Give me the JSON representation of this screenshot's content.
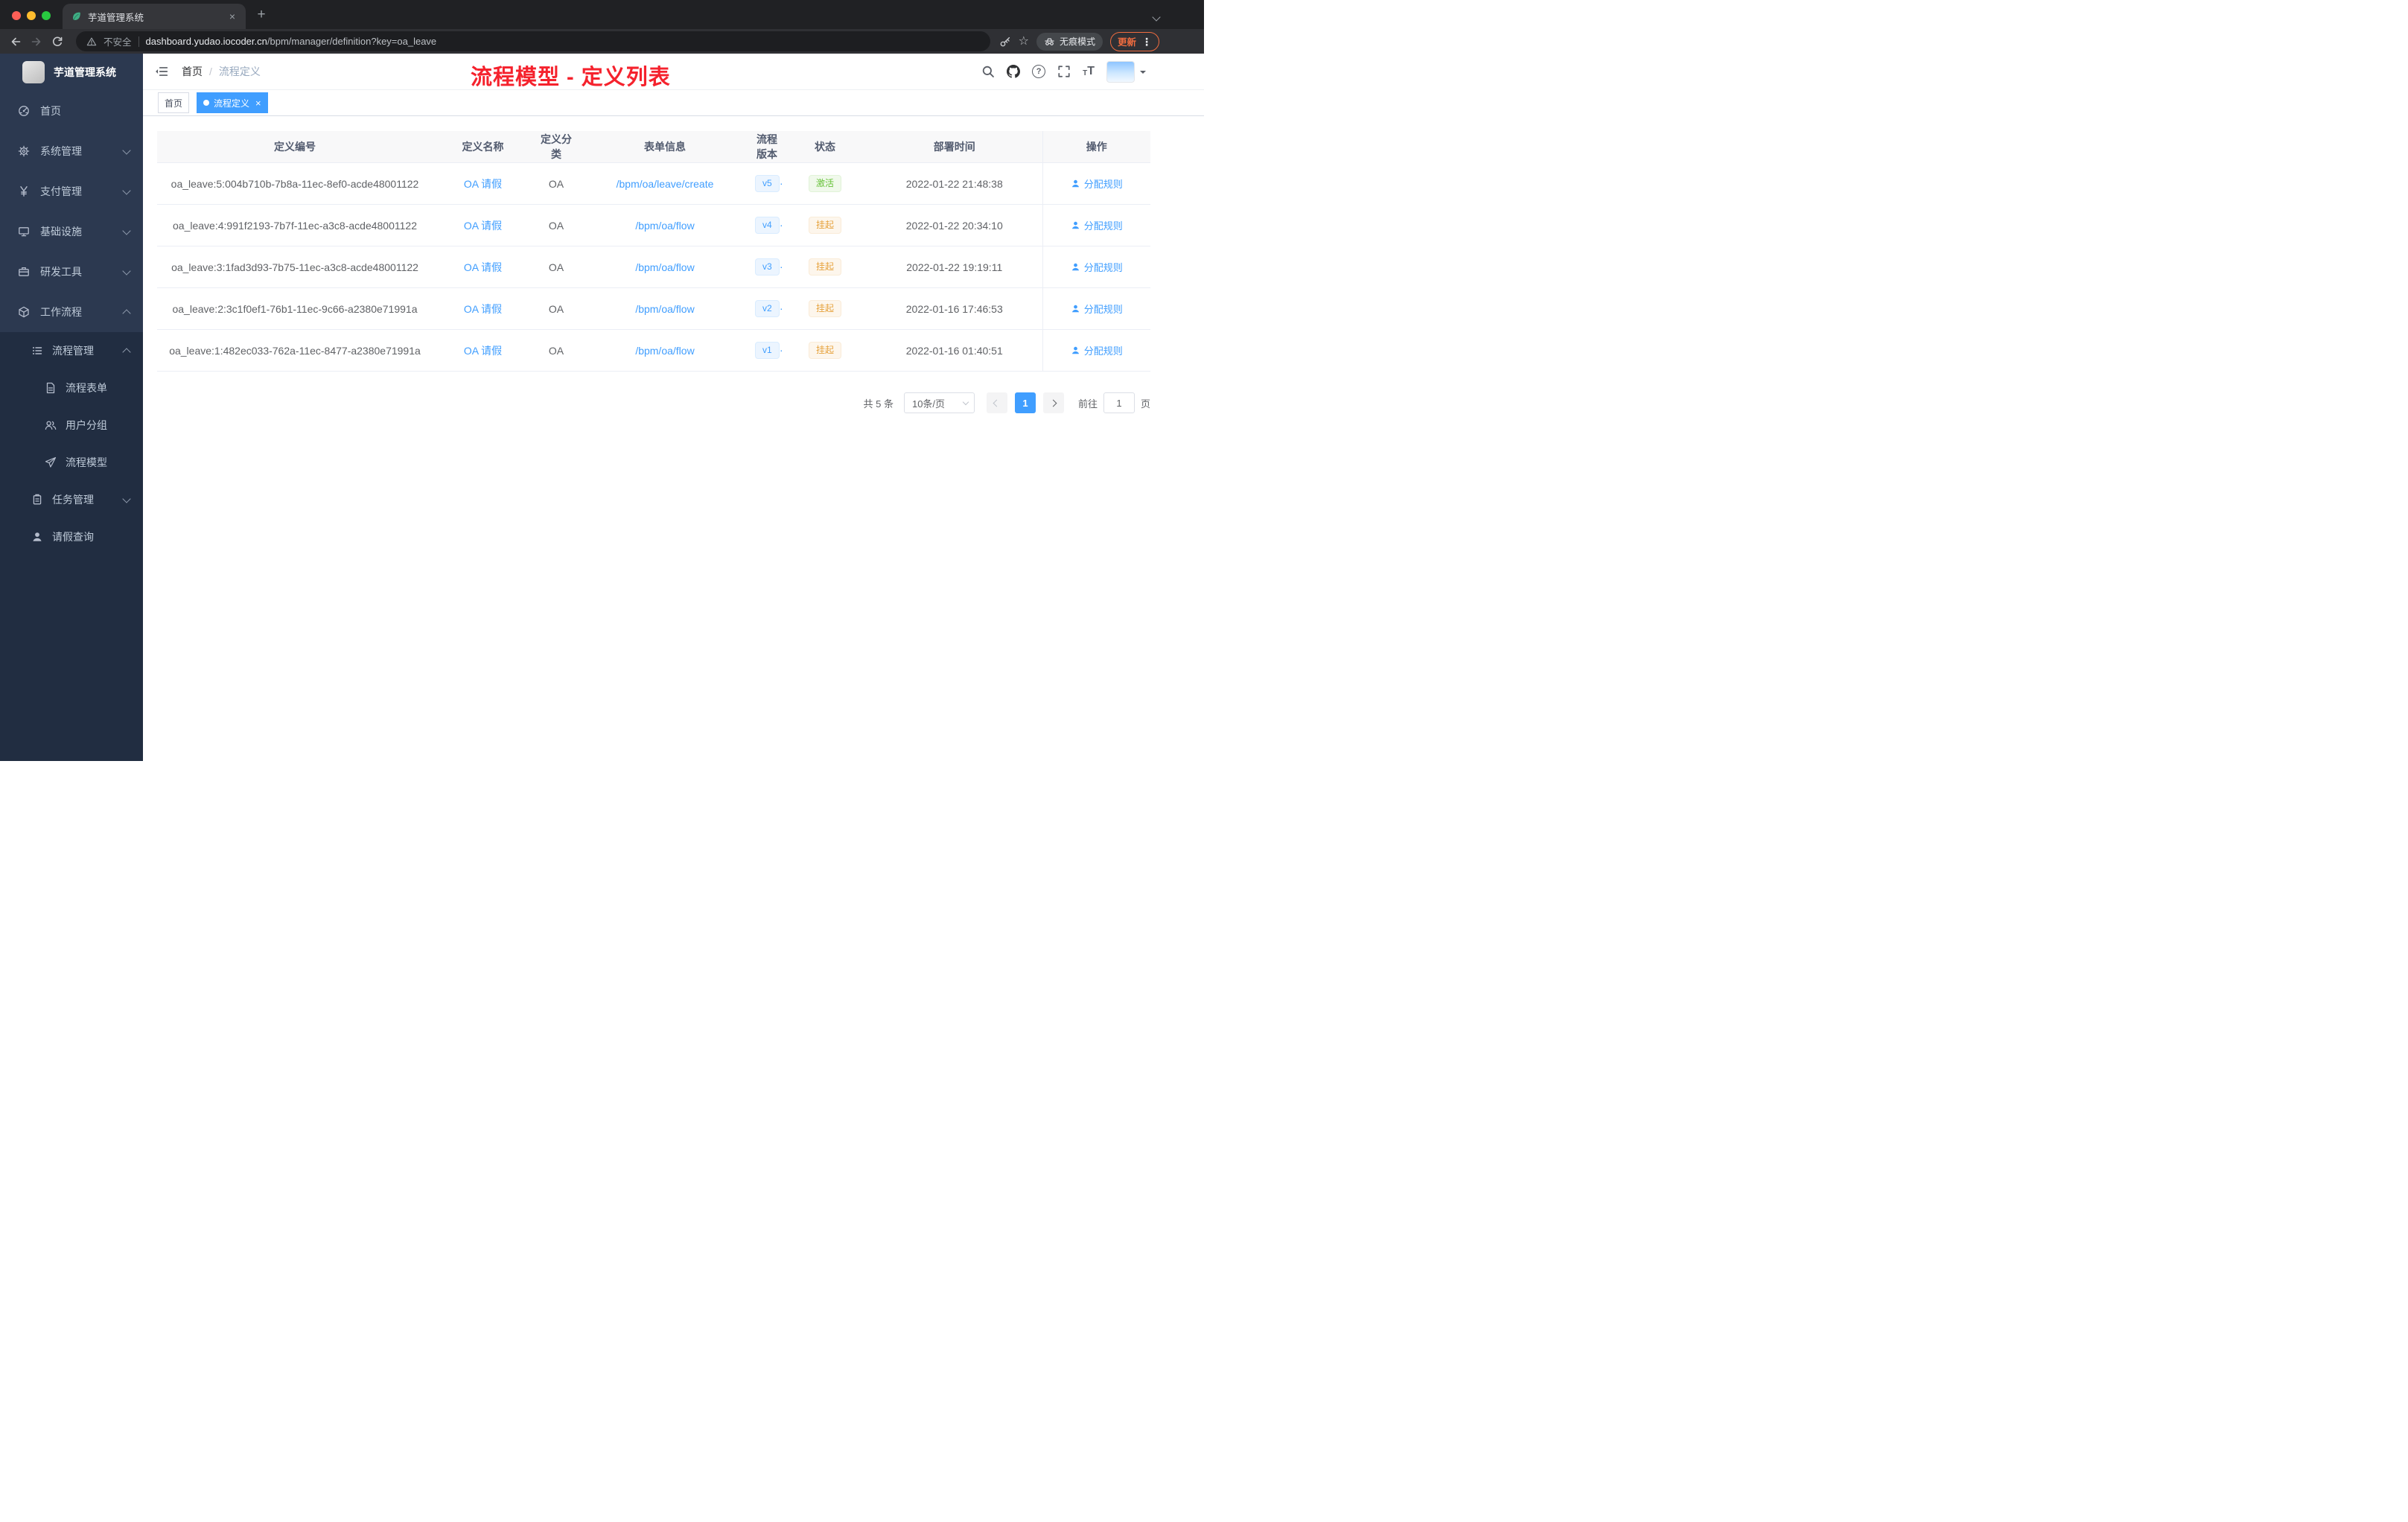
{
  "colors": {
    "accent": "#409eff",
    "success": "#67c23a",
    "warning": "#e6a23c",
    "annotation_red": "#f5222d",
    "update_orange": "#ef6c3f",
    "sidebar_bg": "#2c3950",
    "submenu_bg": "#212d41"
  },
  "browser": {
    "tab_title": "芋道管理系统",
    "security": "不安全",
    "url_domain": "dashboard.yudao.iocoder.cn",
    "url_path": "/bpm/manager/definition?key=oa_leave",
    "incognito": "无痕模式",
    "update": "更新"
  },
  "sidebar": {
    "logo_title": "芋道管理系统",
    "menu": [
      {
        "label": "首页"
      },
      {
        "label": "系统管理"
      },
      {
        "label": "支付管理"
      },
      {
        "label": "基础设施"
      },
      {
        "label": "研发工具"
      },
      {
        "label": "工作流程"
      }
    ],
    "submenu": [
      {
        "label": "流程管理"
      },
      {
        "label": "流程表单"
      },
      {
        "label": "用户分组"
      },
      {
        "label": "流程模型"
      },
      {
        "label": "任务管理"
      },
      {
        "label": "请假查询"
      }
    ]
  },
  "navbar": {
    "breadcrumb_home": "首页",
    "breadcrumb_sep": "/",
    "breadcrumb_current": "流程定义",
    "annotation": "流程模型 - 定义列表"
  },
  "tags": {
    "home": "首页",
    "active": "流程定义"
  },
  "table": {
    "columns": [
      "定义编号",
      "定义名称",
      "定义分类",
      "表单信息",
      "流程版本",
      "状态",
      "部署时间",
      "操作"
    ],
    "action_label": "分配规则",
    "rows": [
      {
        "id": "oa_leave:5:004b710b-7b8a-11ec-8ef0-acde48001122",
        "name": "OA 请假",
        "category": "OA",
        "form": "/bpm/oa/leave/create",
        "version": "v5",
        "status": "激活",
        "time": "2022-01-22 21:48:38"
      },
      {
        "id": "oa_leave:4:991f2193-7b7f-11ec-a3c8-acde48001122",
        "name": "OA 请假",
        "category": "OA",
        "form": "/bpm/oa/flow",
        "version": "v4",
        "status": "挂起",
        "time": "2022-01-22 20:34:10"
      },
      {
        "id": "oa_leave:3:1fad3d93-7b75-11ec-a3c8-acde48001122",
        "name": "OA 请假",
        "category": "OA",
        "form": "/bpm/oa/flow",
        "version": "v3",
        "status": "挂起",
        "time": "2022-01-22 19:19:11"
      },
      {
        "id": "oa_leave:2:3c1f0ef1-76b1-11ec-9c66-a2380e71991a",
        "name": "OA 请假",
        "category": "OA",
        "form": "/bpm/oa/flow",
        "version": "v2",
        "status": "挂起",
        "time": "2022-01-16 17:46:53"
      },
      {
        "id": "oa_leave:1:482ec033-762a-11ec-8477-a2380e71991a",
        "name": "OA 请假",
        "category": "OA",
        "form": "/bpm/oa/flow",
        "version": "v1",
        "status": "挂起",
        "time": "2022-01-16 01:40:51"
      }
    ]
  },
  "pagination": {
    "total": "共 5 条",
    "page_size": "10条/页",
    "page": "1",
    "goto_label": "前往",
    "goto_value": "1",
    "page_unit": "页"
  },
  "icons": {
    "close": "×",
    "plus": "+",
    "question": "?",
    "star": "☆",
    "kebab": "⋮",
    "font_small": "T",
    "font_large": "T"
  }
}
